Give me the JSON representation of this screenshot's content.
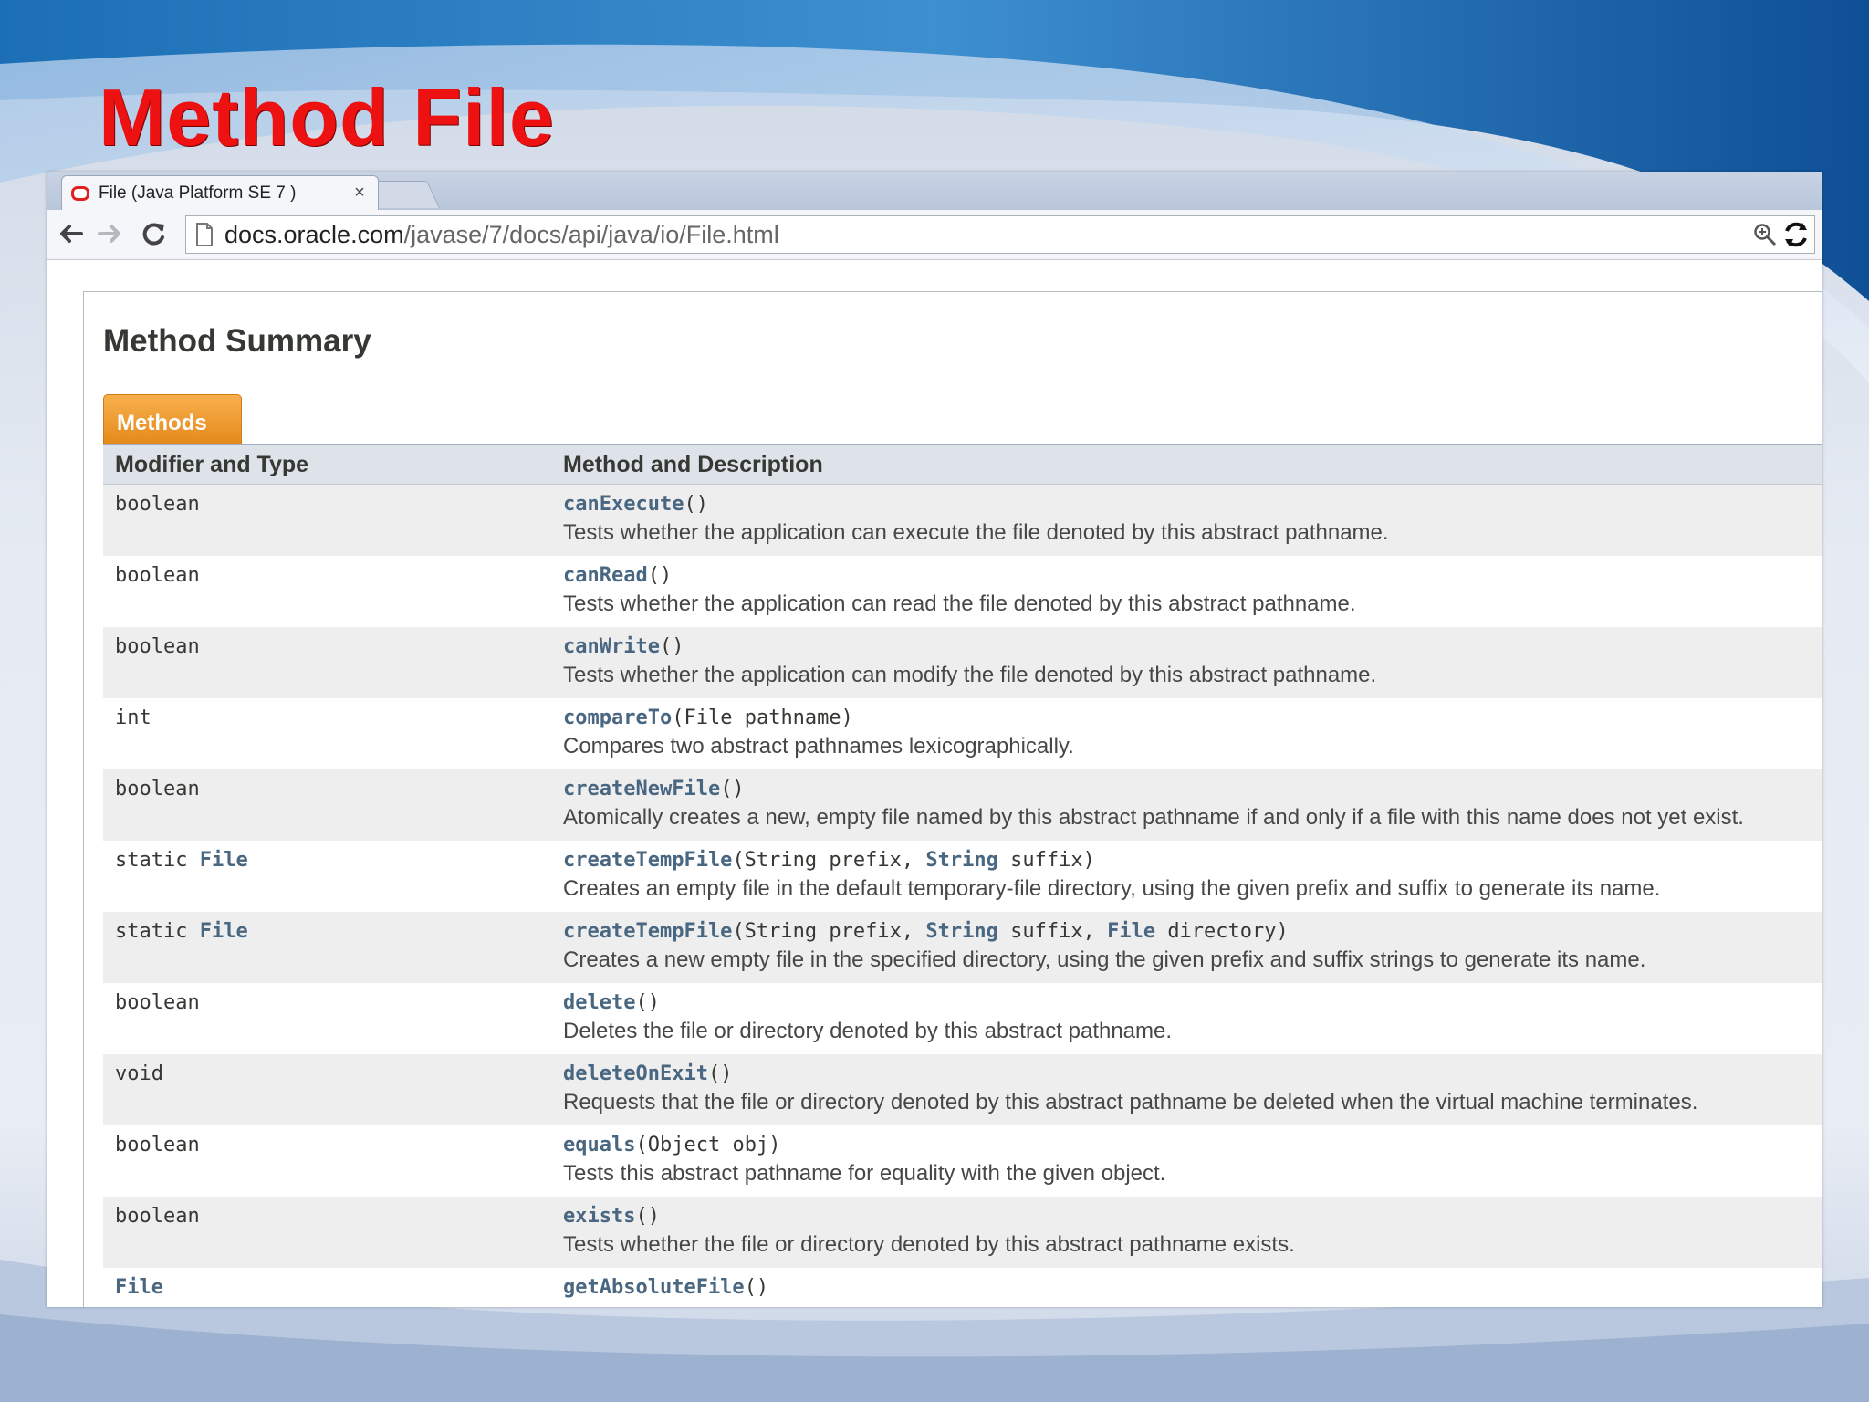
{
  "slide": {
    "title": "Method File"
  },
  "browser": {
    "tab_title": "File (Java Platform SE 7 )",
    "url_host": "docs.oracle.com",
    "url_path": "/javase/7/docs/api/java/io/File.html"
  },
  "page": {
    "section_title": "Method Summary",
    "caption": "Methods",
    "headers": {
      "type": "Modifier and Type",
      "method": "Method and Description"
    },
    "rows": [
      {
        "type": "boolean",
        "sig": "canExecute()",
        "desc": "Tests whether the application can execute the file denoted by this abstract pathname."
      },
      {
        "type": "boolean",
        "sig": "canRead()",
        "desc": "Tests whether the application can read the file denoted by this abstract pathname."
      },
      {
        "type": "boolean",
        "sig": "canWrite()",
        "desc": "Tests whether the application can modify the file denoted by this abstract pathname."
      },
      {
        "type": "int",
        "sig": "compareTo(File pathname)",
        "desc": "Compares two abstract pathnames lexicographically."
      },
      {
        "type": "boolean",
        "sig": "createNewFile()",
        "desc": "Atomically creates a new, empty file named by this abstract pathname if and only if a file with this name does not yet exist."
      },
      {
        "type": "static File",
        "sig": "createTempFile(String prefix, String suffix)",
        "desc": "Creates an empty file in the default temporary-file directory, using the given prefix and suffix to generate its name."
      },
      {
        "type": "static File",
        "sig": "createTempFile(String prefix, String suffix, File directory)",
        "desc": "Creates a new empty file in the specified directory, using the given prefix and suffix strings to generate its name."
      },
      {
        "type": "boolean",
        "sig": "delete()",
        "desc": "Deletes the file or directory denoted by this abstract pathname."
      },
      {
        "type": "void",
        "sig": "deleteOnExit()",
        "desc": "Requests that the file or directory denoted by this abstract pathname be deleted when the virtual machine terminates."
      },
      {
        "type": "boolean",
        "sig": "equals(Object obj)",
        "desc": "Tests this abstract pathname for equality with the given object."
      },
      {
        "type": "boolean",
        "sig": "exists()",
        "desc": "Tests whether the file or directory denoted by this abstract pathname exists."
      },
      {
        "type": "File",
        "sig": "getAbsoluteFile()",
        "desc": ""
      }
    ]
  },
  "theme": {
    "title_color": "#ee1111",
    "link_color": "#4a6782",
    "caption_color": "#f0a030",
    "header_bg": "#dee3e9",
    "alt_row_bg": "#eeeeef"
  },
  "icons": [
    "oracle-favicon",
    "close-icon",
    "back-arrow-icon",
    "forward-arrow-icon",
    "reload-icon",
    "page-icon",
    "zoom-icon",
    "refresh-extension-icon"
  ]
}
